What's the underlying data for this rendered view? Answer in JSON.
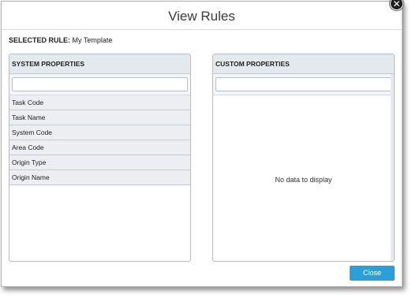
{
  "dialog": {
    "title": "View Rules",
    "close_glyph": "✕",
    "close_icon": "close-circle-icon"
  },
  "selected_rule": {
    "label": "SELECTED RULE:",
    "value": "My Template"
  },
  "system_properties": {
    "header": "SYSTEM PROPERTIES",
    "filter_value": "",
    "items": [
      {
        "label": "Task Code"
      },
      {
        "label": "Task Name"
      },
      {
        "label": "System Code"
      },
      {
        "label": "Area Code"
      },
      {
        "label": "Origin Type"
      },
      {
        "label": "Origin Name"
      }
    ]
  },
  "custom_properties": {
    "header": "CUSTOM PROPERTIES",
    "filter_value": "",
    "empty_message": "No data to display"
  },
  "footer": {
    "close_label": "Close",
    "close_color": "#2aa0da"
  }
}
